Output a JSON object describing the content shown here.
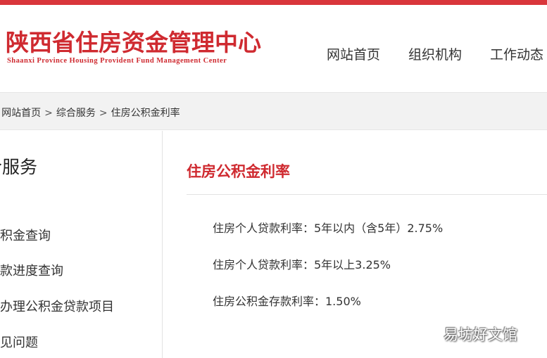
{
  "header": {
    "logo_cn": "陕西省住房资金管理中心",
    "logo_en": "Shaanxi Province Housing Provident Fund Management Center",
    "nav": [
      "网站首页",
      "组织机构",
      "工作动态"
    ]
  },
  "breadcrumb": {
    "prefix": ":",
    "items": [
      "网站首页",
      "综合服务",
      "住房公积金利率"
    ],
    "separator": ">"
  },
  "sidebar": {
    "title": "合服务",
    "items": [
      "公积金查询",
      "贷款进度查询",
      "可办理公积金贷款项目",
      "常见问题"
    ]
  },
  "content": {
    "title": "住房公积金利率",
    "lines": [
      "住房个人贷款利率：5年以内（含5年）2.75%",
      "住房个人贷款利率：5年以上3.25%",
      "住房公积金存款利率：1.50%"
    ]
  },
  "watermark": "易坊好文馆",
  "colors": {
    "brand_red": "#cf2a30",
    "top_bar": "#d9363b",
    "breadcrumb_bg": "#f2f2f2"
  }
}
